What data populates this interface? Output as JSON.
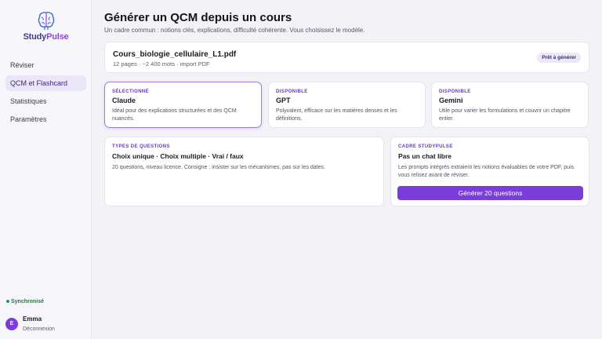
{
  "app": {
    "name_part1": "Study",
    "name_part2": "Pulse"
  },
  "sidebar": {
    "items": [
      {
        "label": "Réviser"
      },
      {
        "label": "QCM et Flashcard"
      },
      {
        "label": "Statistiques"
      },
      {
        "label": "Paramètres"
      }
    ],
    "active_item": "QCM et Flashcard",
    "sync_status": "Synchronisé",
    "user": {
      "initial": "E",
      "name": "Emma",
      "logout": "Déconnexion"
    }
  },
  "header": {
    "title": "Générer un QCM depuis un cours",
    "subtitle": "Un cadre commun : notions clés, explications, difficulté cohérente. Vous choisissez le modèle."
  },
  "file": {
    "name": "Cours_biologie_cellulaire_L1.pdf",
    "meta": "12 pages · ~2 400 mots · import PDF",
    "status": "Prêt à générer"
  },
  "models": [
    {
      "tag": "SÉLECTIONNÉ",
      "name": "Claude",
      "description": "Idéal pour des explications structurées et des QCM nuancés."
    },
    {
      "tag": "DISPONIBLE",
      "name": "GPT",
      "description": "Polyvalent, efficace sur les matières denses et les définitions."
    },
    {
      "tag": "DISPONIBLE",
      "name": "Gemini",
      "description": "Utile pour varier les formulations et couvrir un chapitre entier."
    }
  ],
  "question_types": {
    "tag": "TYPES DE QUESTIONS",
    "title": "Choix unique · Choix multiple · Vrai / faux",
    "text": "20 questions, niveau licence. Consigne : insister sur les mécanismes, pas sur les dates."
  },
  "framework": {
    "tag": "CADRE STUDYPULSE",
    "title": "Pas un chat libre",
    "text": "Les prompts intégrés extraient les notions évaluables de votre PDF, puis vous relisez avant de réviser.",
    "button": "Générer 20 questions"
  },
  "colors": {
    "accent": "#7a3ddb",
    "selected_border": "#9d7ce2",
    "sync": "#1f7a3c"
  }
}
